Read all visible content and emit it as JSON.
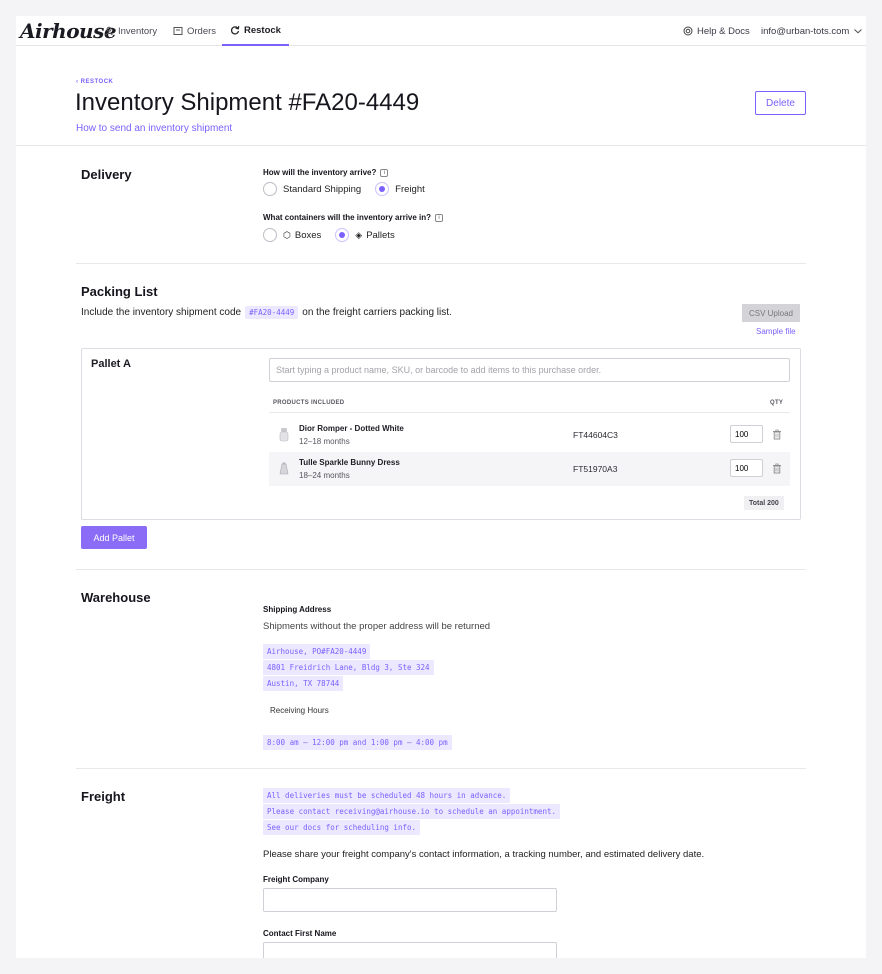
{
  "nav": {
    "logo": "Airhouse",
    "items": [
      {
        "label": "Inventory",
        "icon": "user-icon"
      },
      {
        "label": "Orders",
        "icon": "orders-icon"
      },
      {
        "label": "Restock",
        "icon": "refresh-icon",
        "active": true
      }
    ],
    "help": "Help & Docs",
    "account": "info@urban-tots.com"
  },
  "header": {
    "breadcrumb": "‹ RESTOCK",
    "title": "Inventory Shipment #FA20-4449",
    "subtitle_link": "How to send an inventory shipment",
    "delete_label": "Delete"
  },
  "delivery": {
    "title": "Delivery",
    "arrive_question": "How will the inventory arrive?",
    "arrive_options": [
      "Standard Shipping",
      "Freight"
    ],
    "arrive_selected": "Freight",
    "container_question": "What containers will the inventory arrive in?",
    "container_options": [
      "Boxes",
      "Pallets"
    ],
    "container_selected": "Pallets"
  },
  "packing": {
    "title": "Packing List",
    "text_before": "Include the inventory shipment code",
    "code": "#FA20-4449",
    "text_after": "on the freight carriers packing list.",
    "csv_label": "CSV Upload",
    "sample_label": "Sample file",
    "pallet_name": "Pallet A",
    "search_placeholder": "Start typing a product name, SKU, or barcode to add items to this purchase order.",
    "col_products": "PRODUCTS INCLUDED",
    "col_qty": "QTY",
    "products": [
      {
        "name": "Dior Romper - Dotted White",
        "size": "12–18 months",
        "sku": "FT44604C3",
        "qty": "100"
      },
      {
        "name": "Tulle Sparkle Bunny Dress",
        "size": "18–24 months",
        "sku": "FT51970A3",
        "qty": "100"
      }
    ],
    "total": "Total 200",
    "add_pallet_label": "Add Pallet"
  },
  "warehouse": {
    "title": "Warehouse",
    "address_label": "Shipping Address",
    "address_note": "Shipments without the proper address will be returned",
    "address_lines": [
      "Airhouse, PO#FA20-4449",
      "4801 Freidrich Lane, Bldg 3, Ste 324",
      "Austin, TX 78744"
    ],
    "hours_label": "Receiving Hours",
    "hours": "8:00 am – 12:00 pm and 1:00 pm – 4:00 pm"
  },
  "freight": {
    "title": "Freight",
    "notes": [
      "All deliveries must be scheduled 48 hours in advance.",
      "Please contact receiving@airhouse.io to schedule an appointment.",
      "See our docs for scheduling info."
    ],
    "instructions": "Please share your freight company's contact information, a tracking number, and estimated delivery date.",
    "company_label": "Freight Company",
    "company_value": "",
    "first_name_label": "Contact First Name",
    "first_name_value": ""
  },
  "colors": {
    "accent": "#7b61ff",
    "button": "#8b6cf6"
  }
}
